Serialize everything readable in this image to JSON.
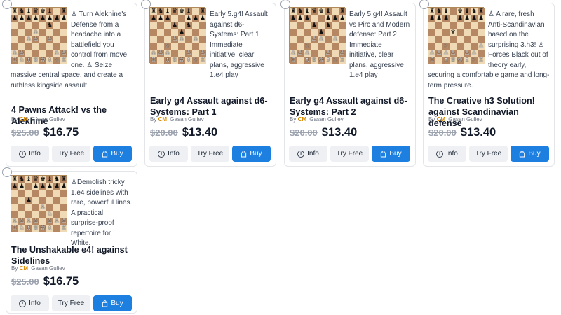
{
  "labels": {
    "by": "By",
    "cm": "CM",
    "author": "Gasan Guliev",
    "info": "Info",
    "try_free": "Try Free",
    "buy": "Buy"
  },
  "cards": [
    {
      "description": "♙ Turn Alekhine's Defense from a headache into a battlefield you control from move one. ♙ Seize massive central space, and create a ruthless kingside assault.",
      "title": "4 Pawns Attack! vs the Alekhine",
      "old_price": "$25.00",
      "new_price": "$16.75"
    },
    {
      "description": "Early 5.g4! Assault against d6-Systems: Part 1 Immediate initiative, clear plans, aggressive 1.e4 play",
      "title": "Early g4 Assault against d6-Systems: Part 1",
      "old_price": "$20.00",
      "new_price": "$13.40"
    },
    {
      "description": "Early 5.g4! Assault vs Pirc and Modern defense: Part 2 Immediate initiative, clear plans, aggressive 1.e4 play",
      "title": "Early g4 Assault against d6-Systems: Part 2",
      "old_price": "$20.00",
      "new_price": "$13.40"
    },
    {
      "description": "♙ A rare, fresh Anti-Scandinavian based on the surprising 3.h3! ♙ Forces Black out of theory early, securing a comfortable game and long-term pressure.",
      "title": "The Creative h3 Solution! against Scandinavian defense",
      "old_price": "$20.00",
      "new_price": "$13.40"
    },
    {
      "description": "♙Demolish tricky 1.e4 sidelines with rare, powerful lines. A practical, surprise-proof repertoire for White.",
      "title": "The Unshakable e4! against Sidelines",
      "old_price": "$25.00",
      "new_price": "$16.75"
    }
  ],
  "boards": [
    [
      "rnbqkb.r",
      "pppppppp",
      ".....n..",
      "...P....",
      "..PP.P..",
      "........",
      "PP....PP",
      "RNBQKBNR"
    ],
    [
      "rnbqkb.r",
      "ppp..ppp",
      "...p.n..",
      "....p...",
      "...PP.P.",
      "..N.....",
      "PPP..P.P",
      "R.BQKBNR"
    ],
    [
      "rnbqkb.r",
      "ppp..ppp",
      "...p.n..",
      "....p...",
      "...PP.P.",
      "..N.....",
      "PPP..P.P",
      "R.BQKBNR"
    ],
    [
      "rnb.kbnr",
      "ppp.pppp",
      "........",
      "...q....",
      "........",
      "..N....P",
      "PPPP.PP.",
      "R.BQKBNR"
    ],
    [
      "rnbqkbnr",
      "pp.ppppp",
      "........",
      "..p.....",
      "....P...",
      ".....N..",
      "PPPP.PPP",
      "RNBQKB.R"
    ]
  ]
}
